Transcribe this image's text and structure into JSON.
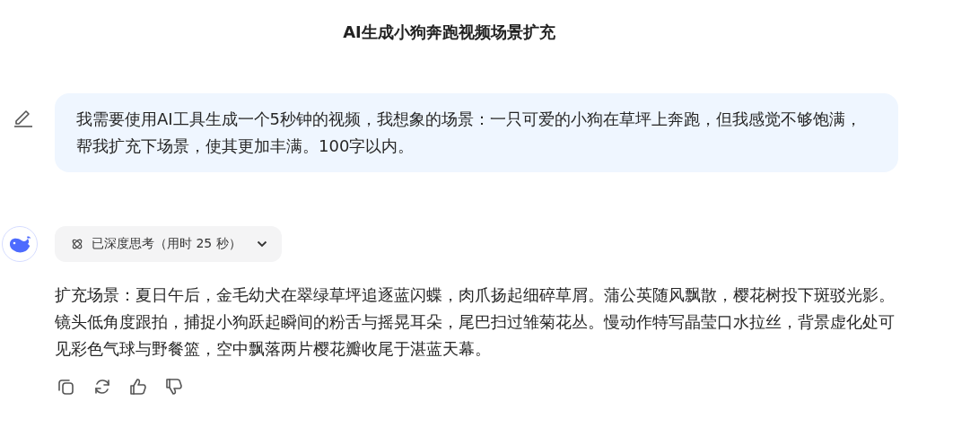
{
  "title": "AI生成小狗奔跑视频场景扩充",
  "user_message": {
    "text": "我需要使用AI工具生成一个5秒钟的视频，我想象的场景：一只可爱的小狗在草坪上奔跑，但我感觉不够饱满，帮我扩充下场景，使其更加丰满。100字以内。"
  },
  "assistant_message": {
    "thinking": {
      "label": "已深度思考（用时 25 秒）"
    },
    "text": "扩充场景：夏日午后，金毛幼犬在翠绿草坪追逐蓝闪蝶，肉爪扬起细碎草屑。蒲公英随风飘散，樱花树投下斑驳光影。镜头低角度跟拍，捕捉小狗跃起瞬间的粉舌与摇晃耳朵，尾巴扫过雏菊花丛。慢动作特写晶莹口水拉丝，背景虚化处可见彩色气球与野餐篮，空中飘落两片樱花瓣收尾于湛蓝天幕。",
    "actions": [
      {
        "kind": "copy"
      },
      {
        "kind": "regenerate"
      },
      {
        "kind": "like"
      },
      {
        "kind": "dislike"
      }
    ]
  }
}
